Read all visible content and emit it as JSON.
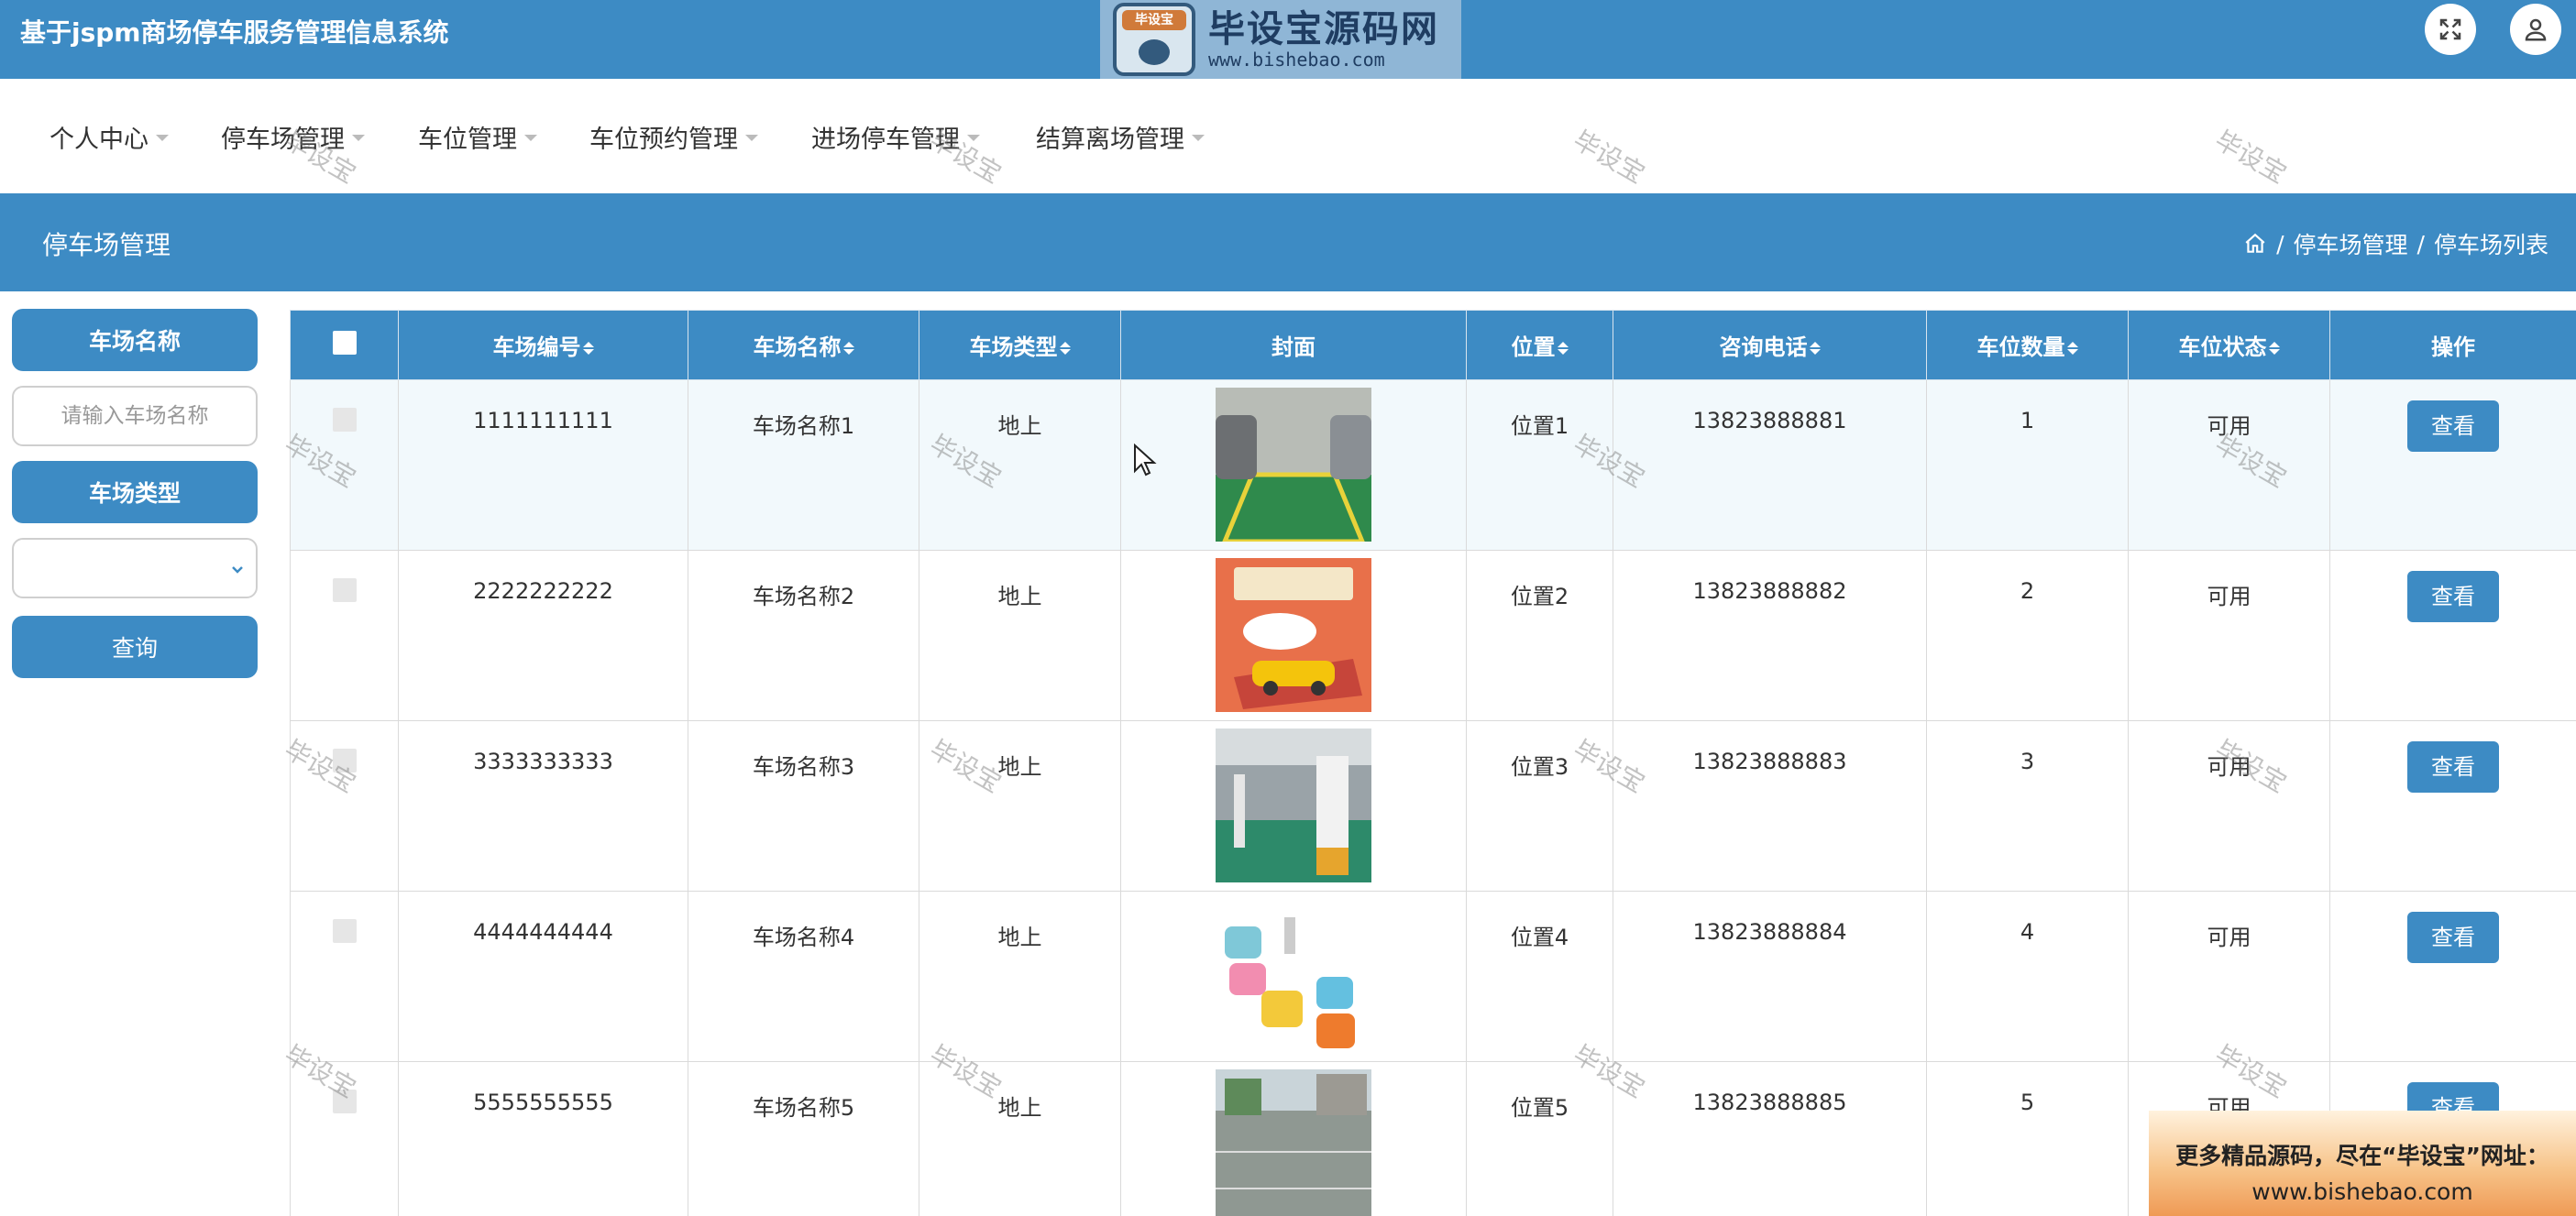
{
  "header": {
    "title": "基于jspm商场停车服务管理信息系统",
    "logo": {
      "cap": "毕设宝",
      "name": "毕设宝源码网",
      "url": "www.bishebao.com"
    }
  },
  "nav": {
    "items": [
      {
        "label": "个人中心"
      },
      {
        "label": "停车场管理"
      },
      {
        "label": "车位管理"
      },
      {
        "label": "车位预约管理"
      },
      {
        "label": "进场停车管理"
      },
      {
        "label": "结算离场管理"
      }
    ]
  },
  "section": {
    "title": "停车场管理",
    "breadcrumb": [
      "停车场管理",
      "停车场列表"
    ],
    "sep": "/"
  },
  "filters": {
    "name_label": "车场名称",
    "name_placeholder": "请输入车场名称",
    "name_value": "",
    "type_label": "车场类型",
    "type_value": "",
    "search_label": "查询"
  },
  "table": {
    "columns": [
      "车场编号",
      "车场名称",
      "车场类型",
      "封面",
      "位置",
      "咨询电话",
      "车位数量",
      "车位状态",
      "操作"
    ],
    "rows": [
      {
        "id": "1111111111",
        "name": "车场名称1",
        "type": "地上",
        "cover": "parking-space-photo",
        "location": "位置1",
        "phone": "13823888881",
        "spaces": "1",
        "status": "可用",
        "action": "查看"
      },
      {
        "id": "2222222222",
        "name": "车场名称2",
        "type": "地上",
        "cover": "poster-with-car",
        "location": "位置2",
        "phone": "13823888882",
        "spaces": "2",
        "status": "可用",
        "action": "查看"
      },
      {
        "id": "3333333333",
        "name": "车场名称3",
        "type": "地上",
        "cover": "underground-garage-photo",
        "location": "位置3",
        "phone": "13823888883",
        "spaces": "3",
        "status": "可用",
        "action": "查看"
      },
      {
        "id": "4444444444",
        "name": "车场名称4",
        "type": "地上",
        "cover": "cartoon-cars-illustration",
        "location": "位置4",
        "phone": "13823888884",
        "spaces": "4",
        "status": "可用",
        "action": "查看"
      },
      {
        "id": "5555555555",
        "name": "车场名称5",
        "type": "地上",
        "cover": "outdoor-lot-photo",
        "location": "位置5",
        "phone": "13823888885",
        "spaces": "5",
        "status": "可用",
        "action": "查看"
      }
    ]
  },
  "watermark": "毕设宝",
  "promo": {
    "line1": "更多精品源码，尽在“毕设宝”网址：",
    "line2": "www.bishebao.com"
  },
  "colors": {
    "primary": "#3d8bc4",
    "row_highlight": "#f2f9fc"
  }
}
